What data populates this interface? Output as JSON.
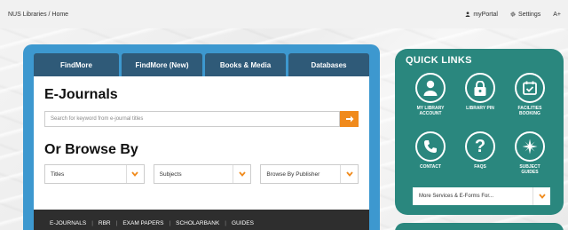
{
  "topbar": {
    "breadcrumb": "NUS Libraries / Home",
    "myportal": "myPortal",
    "settings": "Settings",
    "font_size": "A+"
  },
  "tabs": [
    "FindMore",
    "FindMore (New)",
    "Books & Media",
    "Databases"
  ],
  "ejournals": {
    "heading": "E-Journals",
    "placeholder": "Search for keyword from e-journal titles"
  },
  "browse": {
    "heading": "Or Browse By",
    "selects": [
      "Titles",
      "Subjects",
      "Browse By Publisher"
    ]
  },
  "bottom_nav": [
    "E-JOURNALS",
    "RBR",
    "EXAM PAPERS",
    "SCHOLARBANK",
    "GUIDES"
  ],
  "quick_links": {
    "title": "QUICK LINKS",
    "items": [
      {
        "label1": "MY LIBRARY",
        "label2": "ACCOUNT",
        "icon": "user-icon"
      },
      {
        "label1": "LIBRARY PIN",
        "label2": "",
        "icon": "lock-icon"
      },
      {
        "label1": "FACILITIES",
        "label2": "BOOKING",
        "icon": "calendar-check-icon"
      },
      {
        "label1": "CONTACT",
        "label2": "",
        "icon": "phone-icon"
      },
      {
        "label1": "FAQS",
        "label2": "",
        "icon": "question-icon"
      },
      {
        "label1": "SUBJECT",
        "label2": "GUIDES",
        "icon": "compass-icon"
      }
    ],
    "more_select": "More Services & E-Forms For..."
  },
  "colors": {
    "accent_blue": "#3d98cf",
    "tab_dark": "#2f5a78",
    "orange": "#f08a1c",
    "teal": "#2a877e",
    "nav_dark": "#2e2e2e"
  }
}
